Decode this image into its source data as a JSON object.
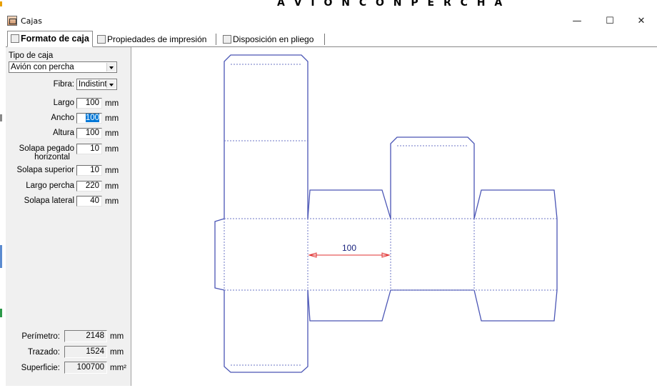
{
  "banner": {
    "text": "A V I Ó N  C O N  P E R C H A"
  },
  "window": {
    "title": "Cajas",
    "controls": {
      "minimize": "—",
      "maximize": "☐",
      "close": "✕"
    }
  },
  "tabs": [
    {
      "label": "Formato de caja",
      "active": true
    },
    {
      "label": "Propiedades de impresión",
      "active": false
    },
    {
      "label": "Disposición en pliego",
      "active": false
    }
  ],
  "form": {
    "box_type_label": "Tipo de caja",
    "box_type_value": "Avión con percha",
    "fibra_label": "Fibra:",
    "fibra_value": "Indistinta",
    "fields": [
      {
        "label": "Largo",
        "value": "100",
        "unit": "mm"
      },
      {
        "label": "Ancho",
        "value": "100",
        "unit": "mm"
      },
      {
        "label": "Altura",
        "value": "100",
        "unit": "mm"
      },
      {
        "label": "Solapa pegado horizontal",
        "label_line1": "Solapa pegado",
        "label_line2": "horizontal",
        "value": "10",
        "unit": "mm"
      },
      {
        "label": "Solapa superior",
        "value": "10",
        "unit": "mm"
      },
      {
        "label": "Largo percha",
        "value": "220",
        "unit": "mm"
      },
      {
        "label": "Solapa lateral",
        "value": "40",
        "unit": "mm"
      }
    ],
    "results": [
      {
        "label": "Perímetro:",
        "value": "2148",
        "unit": "mm"
      },
      {
        "label": "Trazado:",
        "value": "1524",
        "unit": "mm"
      },
      {
        "label": "Superficie:",
        "value": "100700",
        "unit": "mm²"
      }
    ]
  },
  "drawing": {
    "dimension_label": "100",
    "colors": {
      "cut": "#4a55b5",
      "fold": "#6b74c4",
      "dimension": "#e03030",
      "dimension_text": "#1a237e"
    }
  }
}
